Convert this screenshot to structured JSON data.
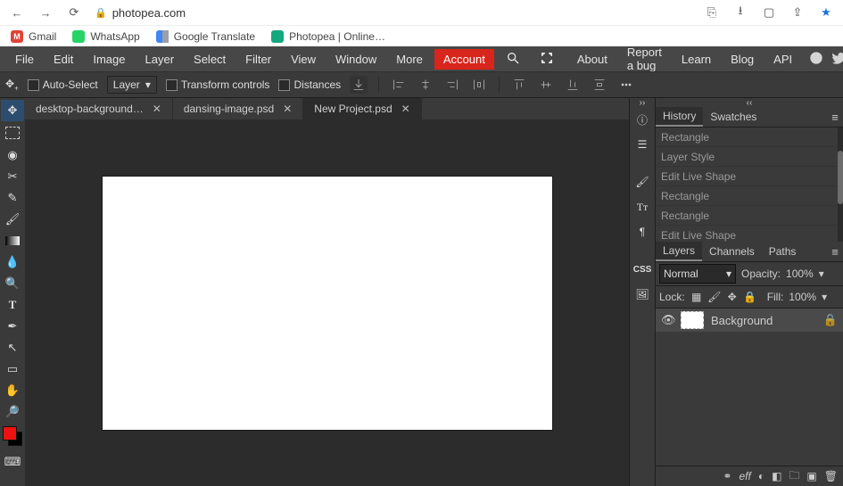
{
  "browser": {
    "url_host": "photopea.com",
    "bookmarks": [
      {
        "label": "Gmail",
        "icon": "gmail"
      },
      {
        "label": "WhatsApp",
        "icon": "whatsapp"
      },
      {
        "label": "Google Translate",
        "icon": "google-translate"
      },
      {
        "label": "Photopea | Online…",
        "icon": "photopea"
      }
    ]
  },
  "menubar": {
    "items": [
      "File",
      "Edit",
      "Image",
      "Layer",
      "Select",
      "Filter",
      "View",
      "Window",
      "More"
    ],
    "account": "Account",
    "links": [
      "About",
      "Report a bug",
      "Learn",
      "Blog",
      "API"
    ]
  },
  "options": {
    "auto_select": "Auto-Select",
    "target_select": "Layer",
    "transform": "Transform controls",
    "distances": "Distances"
  },
  "toolbar": [
    "move",
    "marquee",
    "lasso",
    "crop",
    "eyedropper",
    "brush",
    "gradient",
    "blur",
    "dodge",
    "type",
    "pen",
    "path-select",
    "shape",
    "hand",
    "zoom"
  ],
  "tabs": [
    {
      "label": "desktop-background…",
      "active": false,
      "closeable": true
    },
    {
      "label": "dansing-image.psd",
      "active": false,
      "closeable": true
    },
    {
      "label": "New Project.psd",
      "active": true,
      "closeable": true
    }
  ],
  "right_strip": [
    "info",
    "properties",
    "brushes",
    "type",
    "glyphs",
    "css",
    "image"
  ],
  "history_panel": {
    "tabs": [
      "History",
      "Swatches"
    ],
    "active": "History",
    "items": [
      "Rectangle",
      "Layer Style",
      "Edit Live Shape",
      "Rectangle",
      "Rectangle",
      "Edit Live Shape"
    ]
  },
  "layers_panel": {
    "tabs": [
      "Layers",
      "Channels",
      "Paths"
    ],
    "active": "Layers",
    "blend": "Normal",
    "opacity_label": "Opacity:",
    "opacity_value": "100%",
    "lock_label": "Lock:",
    "fill_label": "Fill:",
    "fill_value": "100%",
    "layers": [
      {
        "name": "Background",
        "locked": true,
        "visible": true
      }
    ],
    "footer_icons": [
      "link",
      "fx",
      "mask",
      "adjustment",
      "group",
      "new-layer",
      "delete"
    ]
  },
  "colors": {
    "foreground": "#e11",
    "background": "#000"
  }
}
